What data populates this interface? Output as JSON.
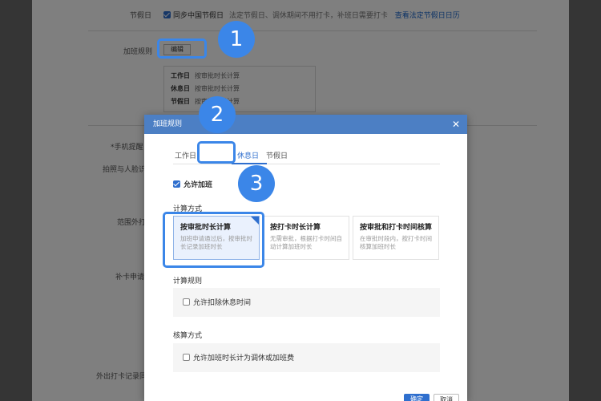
{
  "background": {
    "holiday_label": "节假日",
    "sync_label": "同步中国节假日",
    "sync_desc": "法定节假日、调休期间不用打卡，补班日需要打卡",
    "view_holidays_link": "查看法定节假日日历",
    "ot_rule_label": "加班规则",
    "edit_button": "编辑",
    "rules": [
      {
        "day": "工作日",
        "value": "按审批时长计算"
      },
      {
        "day": "休息日",
        "value": "按审批时长计算"
      },
      {
        "day": "节假日",
        "value": "按审批时长计算"
      }
    ],
    "side_labels": [
      "*手机提醒",
      "拍照与人脸识",
      "范围外打",
      "补卡申请",
      "外出打卡记录同"
    ]
  },
  "badges": [
    "1",
    "2",
    "3"
  ],
  "modal": {
    "title": "加班规则",
    "close_icon": "close-icon",
    "tabs": [
      {
        "label": "工作日",
        "active": false
      },
      {
        "label": "休息日",
        "active": true
      },
      {
        "label": "节假日",
        "active": false
      }
    ],
    "allow_overtime_label": "允许加班",
    "calc_method_title": "计算方式",
    "cards": [
      {
        "title": "按审批时长计算",
        "desc": "加班申请通过后，按审批时长记录加班时长",
        "selected": true
      },
      {
        "title": "按打卡时长计算",
        "desc": "无需审批，根据打卡时间自动计算加班时长",
        "selected": false
      },
      {
        "title": "按审批和打卡时间核算",
        "desc": "在审批时段内，按打卡时间核算加班时长",
        "selected": false
      }
    ],
    "calc_rule_title": "计算规则",
    "deduct_rest_label": "允许扣除休息时间",
    "accounting_title": "核算方式",
    "convert_label": "允许加班时长计为调休或加班费",
    "ok_button": "确定",
    "cancel_button": "取消"
  },
  "colors": {
    "accent": "#3b86e8",
    "header": "#4c7fc4",
    "primary": "#2f6fce"
  }
}
